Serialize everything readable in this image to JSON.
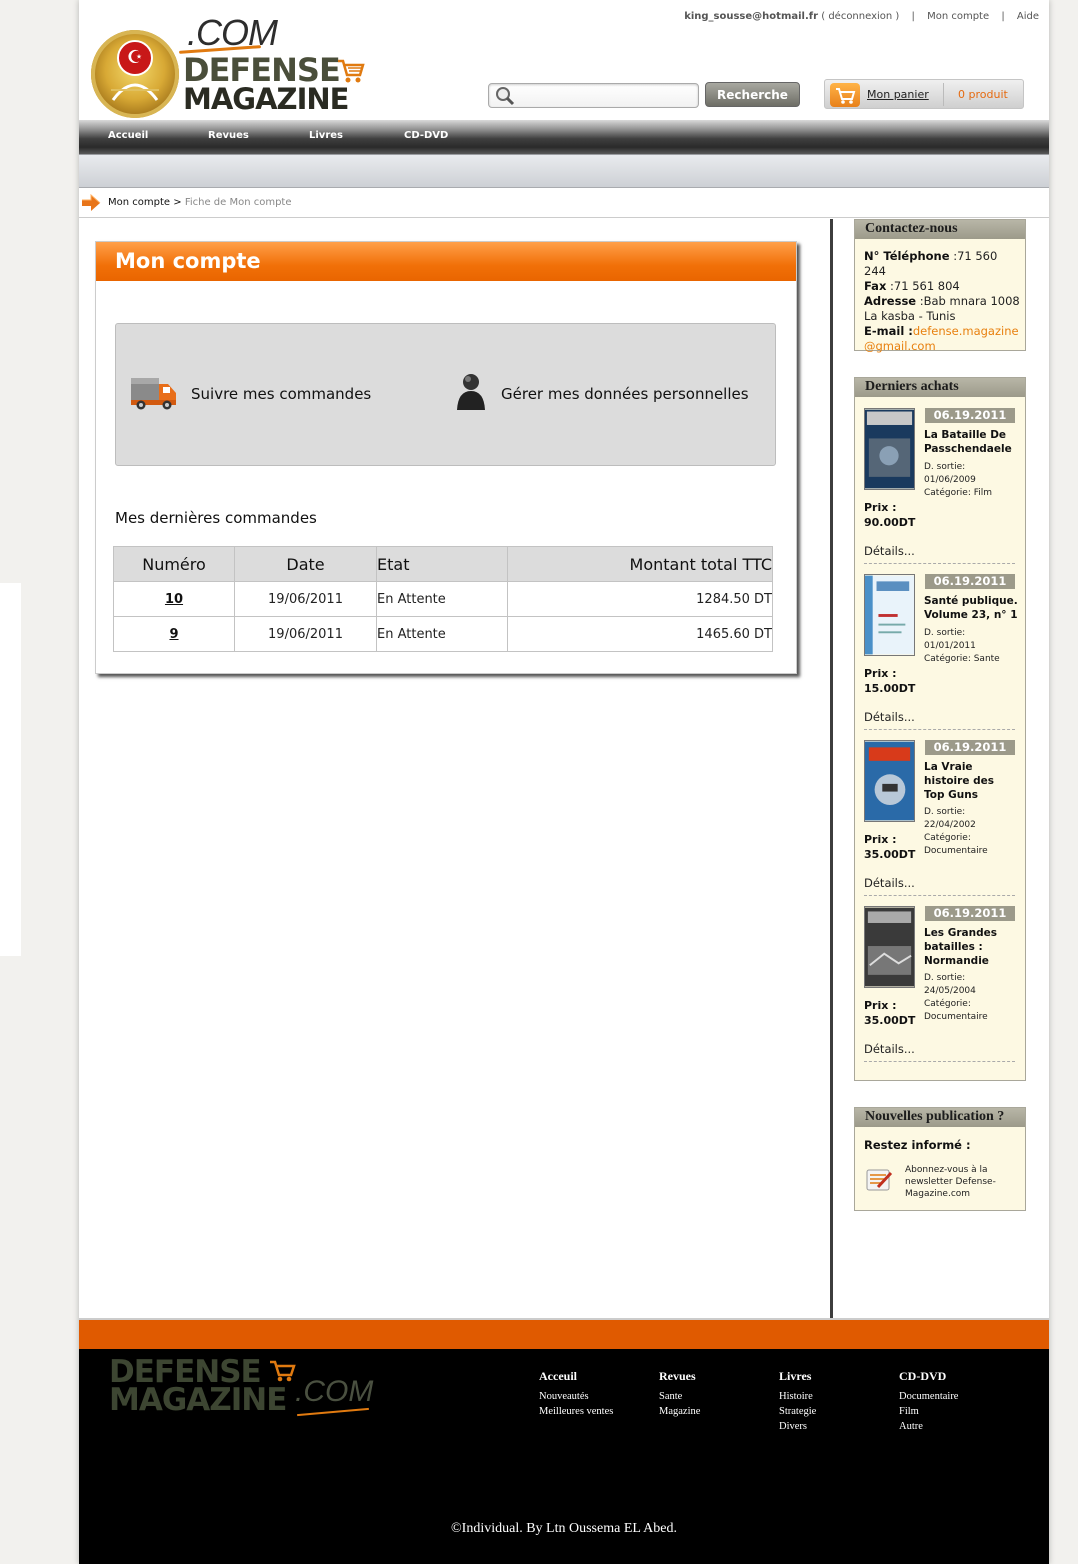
{
  "header": {
    "user_email": "king_sousse@hotmail.fr",
    "logout_text": "( déconnexion )",
    "account_link": "Mon compte",
    "help_link": "Aide",
    "logo_com": ".COM",
    "logo_defense": "DEFENSE",
    "logo_magazine": "MAGAZINE",
    "search_placeholder": "",
    "search_button": "Recherche",
    "cart_label": "Mon panier",
    "cart_count": "0 produit"
  },
  "nav": {
    "items": [
      {
        "label": "Accueil"
      },
      {
        "label": "Revues"
      },
      {
        "label": "Livres"
      },
      {
        "label": "CD-DVD"
      }
    ]
  },
  "breadcrumb": {
    "root": "Mon compte",
    "separator": ">",
    "current": "Fiche de Mon compte"
  },
  "main": {
    "panel_title": "Mon compte",
    "action_orders": "Suivre mes commandes",
    "action_profile": "Gérer mes données personnelles",
    "orders_title": "Mes dernières commandes",
    "columns": [
      "Numéro",
      "Date",
      "Etat",
      "Montant total TTC"
    ],
    "orders": [
      {
        "number": "10",
        "date": "19/06/2011",
        "status": "En Attente",
        "total": "1284.50 DT"
      },
      {
        "number": "9",
        "date": "19/06/2011",
        "status": "En Attente",
        "total": "1465.60 DT"
      }
    ]
  },
  "sidebar": {
    "contact": {
      "title": "Contactez-nous",
      "phone_label": "N° Téléphone",
      "phone": ":71 560 244",
      "fax_label": "Fax",
      "fax": ":71 561 804",
      "address_label": "Adresse",
      "address": ":Bab mnara 1008",
      "address2": "La kasba - Tunis",
      "email_label": "E-mail :",
      "email": "defense.magazine@gmail.com"
    },
    "recent": {
      "title": "Derniers achats",
      "products": [
        {
          "date": "06.19.2011",
          "title": "La Bataille De Passchendaele",
          "release": "D. sortie: 01/06/2009",
          "category": "Catégorie: Film",
          "price_label": "Prix :",
          "price": "90.00DT",
          "details": "Détails..."
        },
        {
          "date": "06.19.2011",
          "title": "Santé publique. Volume 23, n° 1",
          "release": "D. sortie: 01/01/2011",
          "category": "Catégorie: Sante",
          "price_label": "Prix :",
          "price": "15.00DT",
          "details": "Détails..."
        },
        {
          "date": "06.19.2011",
          "title": "La Vraie histoire des Top Guns",
          "release": "D. sortie: 22/04/2002",
          "category": "Catégorie: Documentaire",
          "price_label": "Prix :",
          "price": "35.00DT",
          "details": "Détails..."
        },
        {
          "date": "06.19.2011",
          "title": "Les Grandes batailles : Normandie",
          "release": "D. sortie: 24/05/2004",
          "category": "Catégorie: Documentaire",
          "price_label": "Prix :",
          "price": "35.00DT",
          "details": "Détails..."
        }
      ]
    },
    "newsletter": {
      "title": "Nouvelles publication ?",
      "subtitle": "Restez informé :",
      "text": "Abonnez-vous à la newsletter Defense-Magazine.com"
    }
  },
  "footer": {
    "logo_defense": "DEFENSE",
    "logo_magazine": "MAGAZINE",
    "logo_com": ".COM",
    "columns": [
      {
        "heading": "Acceuil",
        "links": [
          "Nouveautés",
          "Meilleures ventes"
        ]
      },
      {
        "heading": "Revues",
        "links": [
          "Sante",
          "Magazine"
        ]
      },
      {
        "heading": "Livres",
        "links": [
          "Histoire",
          "Strategie",
          "Divers"
        ]
      },
      {
        "heading": "CD-DVD",
        "links": [
          "Documentaire",
          "Film",
          "Autre"
        ]
      }
    ],
    "copyright": "©Individual. By Ltn Oussema EL Abed."
  },
  "colors": {
    "accent": "#f17008",
    "footer_band": "#e05a00",
    "sidebar_bg": "#fdf9e3",
    "sidebar_head": "#9c9a8a"
  },
  "icons": [
    "search-icon",
    "cart-icon",
    "truck-icon",
    "person-icon",
    "arrow-icon",
    "newsletter-icon",
    "emblem-logo"
  ]
}
